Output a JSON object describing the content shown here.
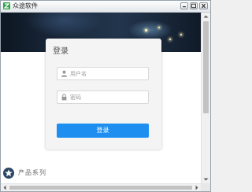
{
  "window": {
    "title": "众途软件",
    "icon": "app-logo-icon",
    "controls": [
      "minimize-icon",
      "maximize-icon",
      "close-icon"
    ]
  },
  "login": {
    "heading": "登录",
    "username_placeholder": "用户名",
    "username_value": "",
    "password_placeholder": "密码",
    "password_value": "",
    "submit_label": "登录",
    "accent_color": "#1e8ff0"
  },
  "section": {
    "label": "产品系列",
    "icon": "star-icon"
  }
}
